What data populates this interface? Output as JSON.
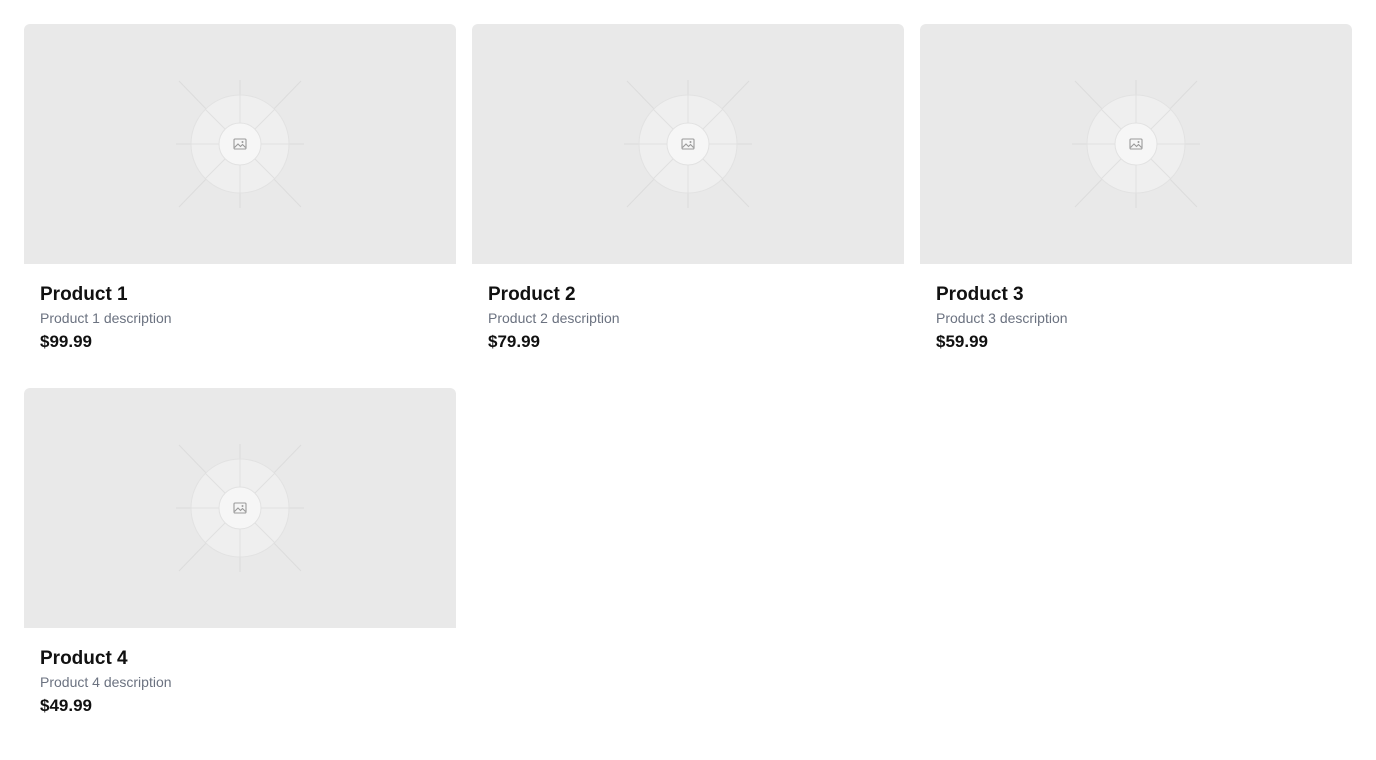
{
  "products": [
    {
      "title": "Product 1",
      "description": "Product 1 description",
      "price": "$99.99",
      "image_icon": "image-placeholder-icon"
    },
    {
      "title": "Product 2",
      "description": "Product 2 description",
      "price": "$79.99",
      "image_icon": "image-placeholder-icon"
    },
    {
      "title": "Product 3",
      "description": "Product 3 description",
      "price": "$59.99",
      "image_icon": "image-placeholder-icon"
    },
    {
      "title": "Product 4",
      "description": "Product 4 description",
      "price": "$49.99",
      "image_icon": "image-placeholder-icon"
    }
  ],
  "colors": {
    "page_background": "#ffffff",
    "image_placeholder": "#e9e9e9",
    "title_text": "#111111",
    "description_text": "#6b7280"
  }
}
